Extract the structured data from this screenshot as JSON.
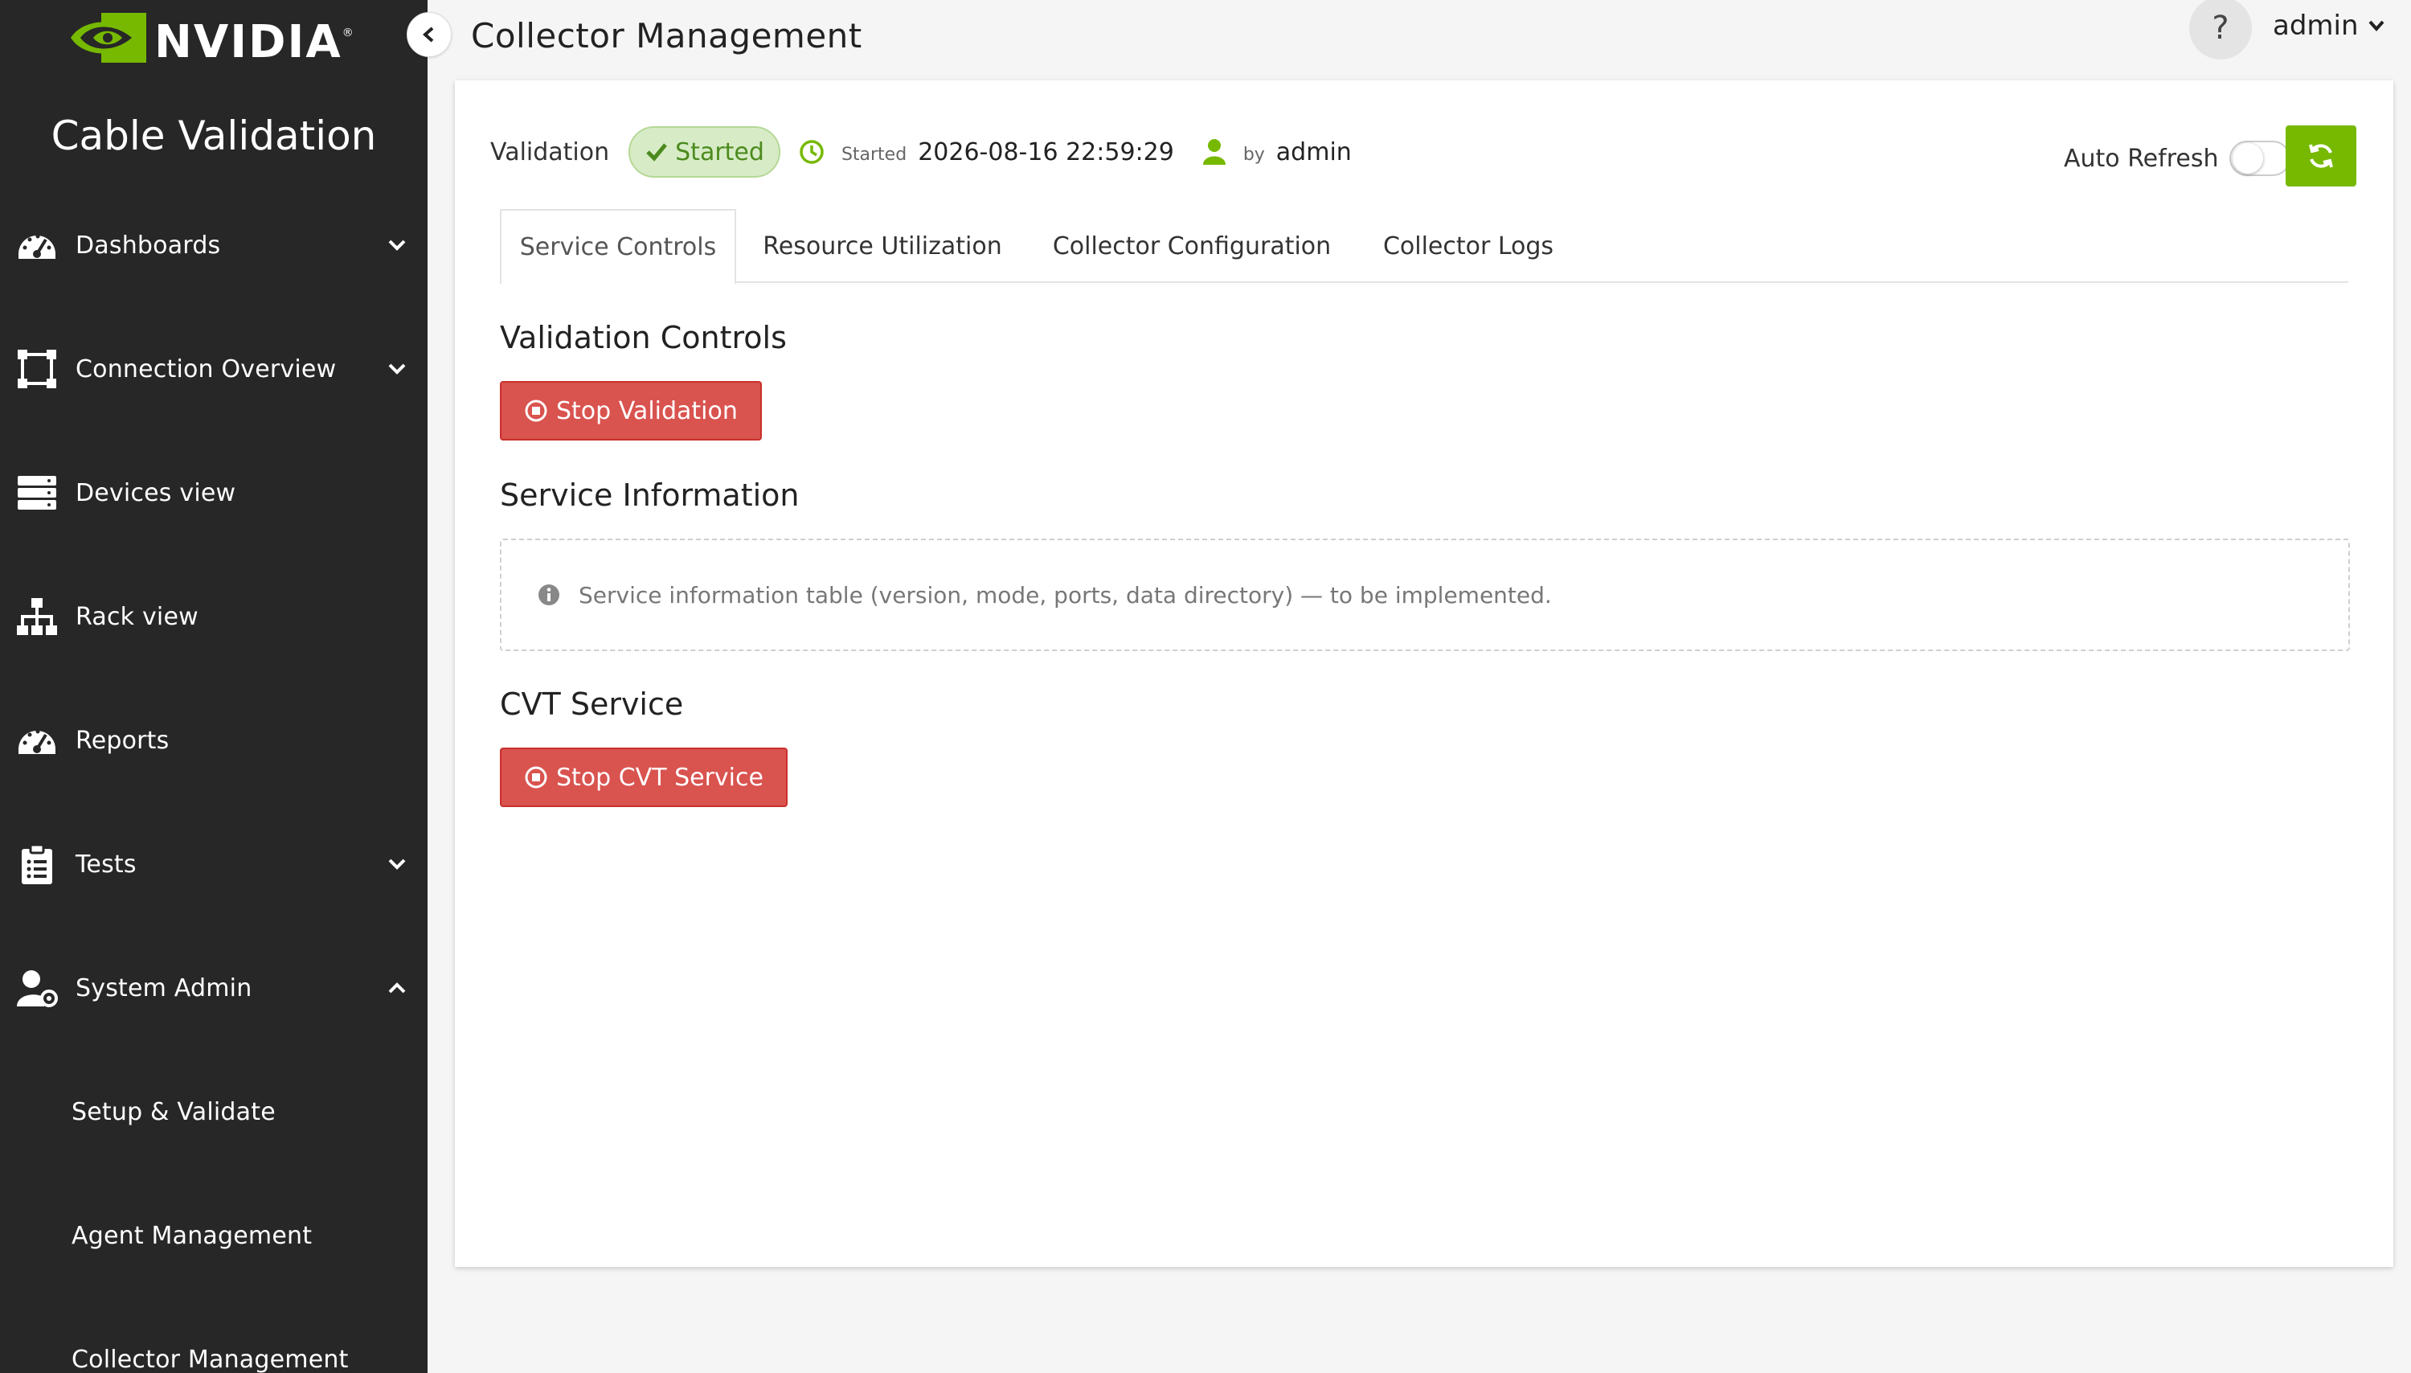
{
  "brand": {
    "name": "NVIDIA",
    "app_title": "Cable Validation"
  },
  "sidebar": {
    "items": [
      {
        "label": "Dashboards",
        "icon": "gauge-icon"
      },
      {
        "label": "Connection Overview",
        "icon": "vector-square-icon"
      },
      {
        "label": "Devices view",
        "icon": "server-icon"
      },
      {
        "label": "Rack view",
        "icon": "sitemap-icon"
      },
      {
        "label": "Reports",
        "icon": "gauge-icon"
      },
      {
        "label": "Tests",
        "icon": "clipboard-list-icon"
      },
      {
        "label": "System Admin",
        "icon": "user-gear-icon"
      }
    ],
    "sub_items": [
      {
        "label": "Setup & Validate"
      },
      {
        "label": "Agent Management"
      },
      {
        "label": "Collector Management"
      }
    ]
  },
  "header": {
    "title": "Collector Management",
    "help": "?",
    "user": "admin"
  },
  "status": {
    "label": "Validation",
    "badge": "Started",
    "started_label": "Started",
    "started_time": "2026-08-16 22:59:29",
    "by_label": "by",
    "by_user": "admin",
    "auto_refresh_label": "Auto Refresh",
    "auto_refresh_on": false
  },
  "tabs": [
    {
      "label": "Service Controls",
      "active": true
    },
    {
      "label": "Resource Utilization",
      "active": false
    },
    {
      "label": "Collector Configuration",
      "active": false
    },
    {
      "label": "Collector Logs",
      "active": false
    }
  ],
  "sections": {
    "validation_controls": {
      "title": "Validation Controls",
      "button": "Stop Validation"
    },
    "service_information": {
      "title": "Service Information",
      "info": "Service information table (version, mode, ports, data directory) — to be implemented."
    },
    "cvt_service": {
      "title": "CVT Service",
      "button": "Stop CVT Service"
    }
  },
  "colors": {
    "sidebar_bg": "#272727",
    "brand_green": "#76b900",
    "danger": "#d9534f",
    "badge_bg": "#d7ecc6"
  }
}
